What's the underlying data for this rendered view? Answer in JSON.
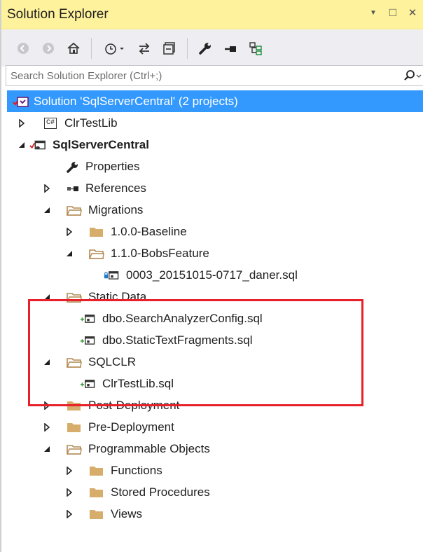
{
  "panel": {
    "title": "Solution Explorer",
    "controls": {
      "dropdown": "▼",
      "maximize": "□",
      "close": "✕"
    }
  },
  "toolbar": {
    "items": [
      "back-icon",
      "forward-icon",
      "home-icon",
      "history-icon",
      "sync-icon",
      "collapse-all-icon",
      "properties-wrench-icon",
      "pending-changes-icon",
      "show-all-files-icon"
    ]
  },
  "search": {
    "placeholder": "Search Solution Explorer (Ctrl+;)"
  },
  "tree": {
    "solution": "Solution 'SqlServerCentral' (2 projects)",
    "clrtestlib_project": "ClrTestLib",
    "csharp_badge": "C#",
    "sqlservercentral_project": "SqlServerCentral",
    "properties": "Properties",
    "references": "References",
    "migrations": "Migrations",
    "baseline": "1.0.0-Baseline",
    "bobsfeature": "1.1.0-BobsFeature",
    "migration_file": "0003_20151015-0717_daner.sql",
    "static_data": "Static Data",
    "search_analyzer": "dbo.SearchAnalyzerConfig.sql",
    "static_text": "dbo.StaticTextFragments.sql",
    "sqlclr": "SQLCLR",
    "clrtestlib_sql": "ClrTestLib.sql",
    "post_deployment": "Post-Deployment",
    "pre_deployment": "Pre-Deployment",
    "programmable_objects": "Programmable Objects",
    "functions": "Functions",
    "stored_procedures": "Stored Procedures",
    "views": "Views"
  },
  "colors": {
    "title_bar": "#fff29d",
    "selection": "#3399ff",
    "highlight_box": "#e8202a",
    "folder_tan": "#d6ad6b",
    "added_plus": "#3a9c3a"
  }
}
